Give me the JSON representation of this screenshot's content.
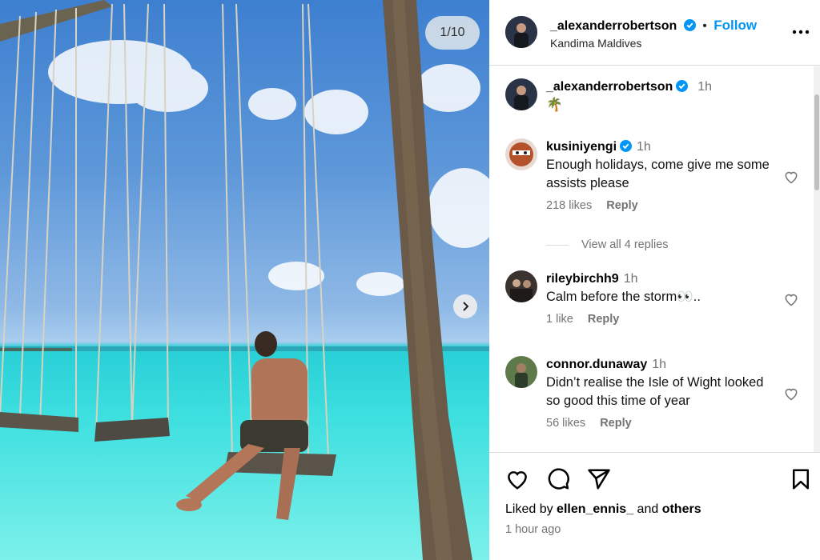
{
  "photo": {
    "counter": "1/10",
    "colors": {
      "sky": "#4a87d2",
      "sea": "#34d8dc",
      "palm_trunk": "#6b5a48"
    }
  },
  "header": {
    "username": "_alexanderrobertson",
    "follow_separator": "•",
    "follow_label": "Follow",
    "location": "Kandima Maldives"
  },
  "caption": {
    "username": "_alexanderrobertson",
    "time": "1h",
    "text": "🌴"
  },
  "comments": [
    {
      "username": "kusiniyengi",
      "verified": true,
      "time": "1h",
      "text": "Enough holidays, come give me some assists please",
      "likes": "218 likes",
      "reply": "Reply",
      "view_replies": "View all 4 replies"
    },
    {
      "username": "rileybirchh9",
      "verified": false,
      "time": "1h",
      "text": "Calm before the storm👀..",
      "likes": "1 like",
      "reply": "Reply"
    },
    {
      "username": "connor.dunaway",
      "verified": false,
      "time": "1h",
      "text": "Didn’t realise the Isle of Wight looked so good this time of year",
      "likes": "56 likes",
      "reply": "Reply"
    }
  ],
  "footer": {
    "liked_prefix": "Liked by",
    "liked_user": "ellen_ennis_",
    "liked_and": "and",
    "liked_others": "others",
    "time_ago": "1 hour ago"
  },
  "icons": [
    "verified-badge-icon",
    "more-options-icon",
    "heart-icon",
    "comment-icon",
    "share-icon",
    "bookmark-icon",
    "chevron-right-icon"
  ],
  "accent_color": "#0095f6"
}
